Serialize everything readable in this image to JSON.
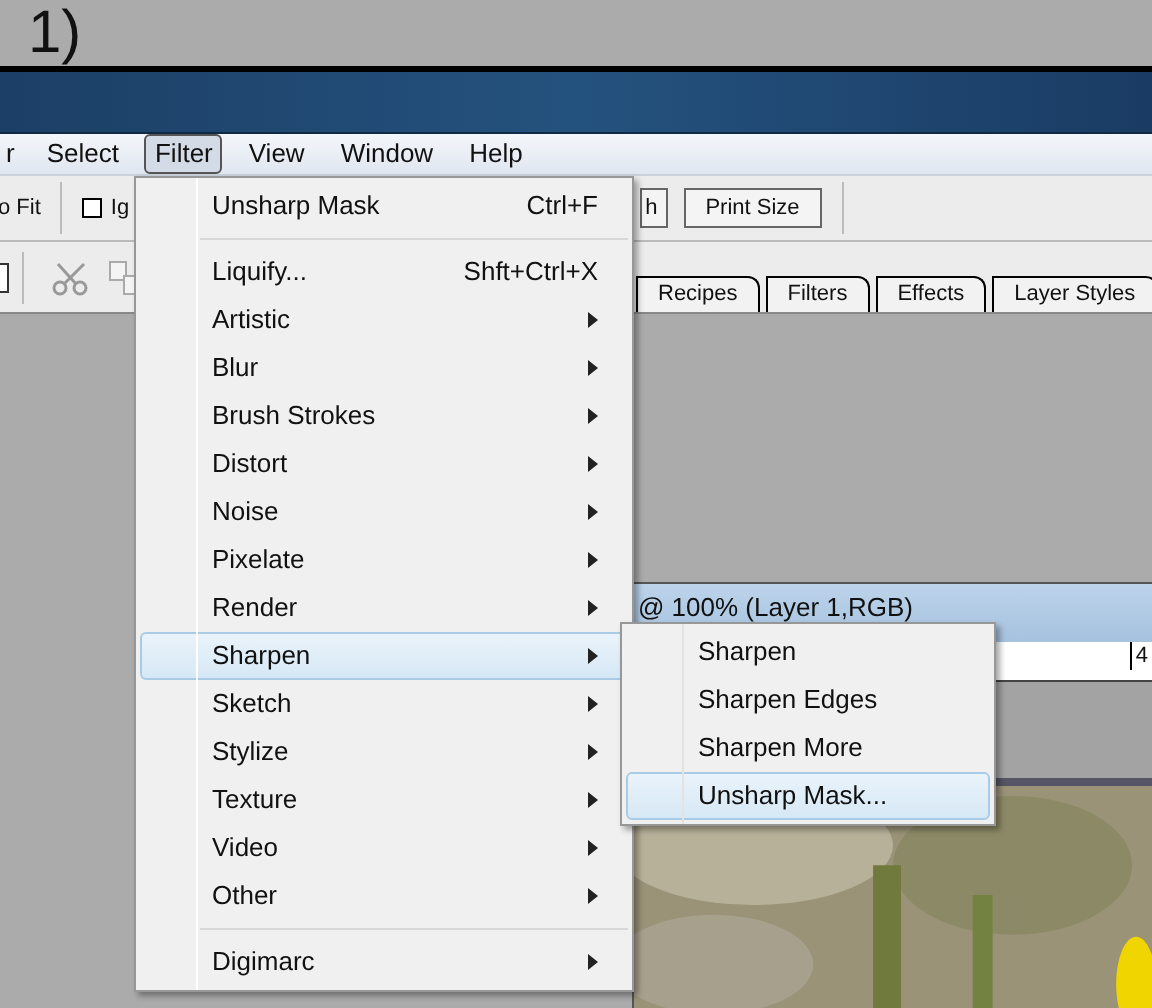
{
  "caption": "1)",
  "menubar": {
    "items": [
      {
        "label": "r",
        "selected": false
      },
      {
        "label": "Select",
        "selected": false
      },
      {
        "label": "Filter",
        "selected": true
      },
      {
        "label": "View",
        "selected": false
      },
      {
        "label": "Window",
        "selected": false
      },
      {
        "label": "Help",
        "selected": false
      }
    ]
  },
  "toolbar": {
    "fit_button": "o Fit",
    "checkbox": {
      "label": "Ig",
      "checked": false
    },
    "partial_button": "h",
    "print_size_button": "Print Size"
  },
  "palette_tabs": [
    {
      "label": "Recipes"
    },
    {
      "label": "Filters"
    },
    {
      "label": "Effects"
    },
    {
      "label": "Layer Styles"
    }
  ],
  "document": {
    "title": "@ 100% (Layer 1,RGB)",
    "ruler_label": "4"
  },
  "filter_menu": {
    "items": [
      {
        "kind": "item",
        "label": "Unsharp Mask",
        "shortcut": "Ctrl+F",
        "submenu": false,
        "selected": false
      },
      {
        "kind": "separator"
      },
      {
        "kind": "item",
        "label": "Liquify...",
        "shortcut": "Shft+Ctrl+X",
        "submenu": false,
        "selected": false
      },
      {
        "kind": "item",
        "label": "Artistic",
        "submenu": true,
        "selected": false
      },
      {
        "kind": "item",
        "label": "Blur",
        "submenu": true,
        "selected": false
      },
      {
        "kind": "item",
        "label": "Brush Strokes",
        "submenu": true,
        "selected": false
      },
      {
        "kind": "item",
        "label": "Distort",
        "submenu": true,
        "selected": false
      },
      {
        "kind": "item",
        "label": "Noise",
        "submenu": true,
        "selected": false
      },
      {
        "kind": "item",
        "label": "Pixelate",
        "submenu": true,
        "selected": false
      },
      {
        "kind": "item",
        "label": "Render",
        "submenu": true,
        "selected": false
      },
      {
        "kind": "item",
        "label": "Sharpen",
        "submenu": true,
        "selected": true
      },
      {
        "kind": "item",
        "label": "Sketch",
        "submenu": true,
        "selected": false
      },
      {
        "kind": "item",
        "label": "Stylize",
        "submenu": true,
        "selected": false
      },
      {
        "kind": "item",
        "label": "Texture",
        "submenu": true,
        "selected": false
      },
      {
        "kind": "item",
        "label": "Video",
        "submenu": true,
        "selected": false
      },
      {
        "kind": "item",
        "label": "Other",
        "submenu": true,
        "selected": false
      },
      {
        "kind": "separator"
      },
      {
        "kind": "item",
        "label": "Digimarc",
        "submenu": true,
        "selected": false
      }
    ]
  },
  "sharpen_submenu": {
    "items": [
      {
        "label": "Sharpen",
        "selected": false
      },
      {
        "label": "Sharpen Edges",
        "selected": false
      },
      {
        "label": "Sharpen More",
        "selected": false
      },
      {
        "label": "Unsharp Mask...",
        "selected": true
      }
    ]
  }
}
